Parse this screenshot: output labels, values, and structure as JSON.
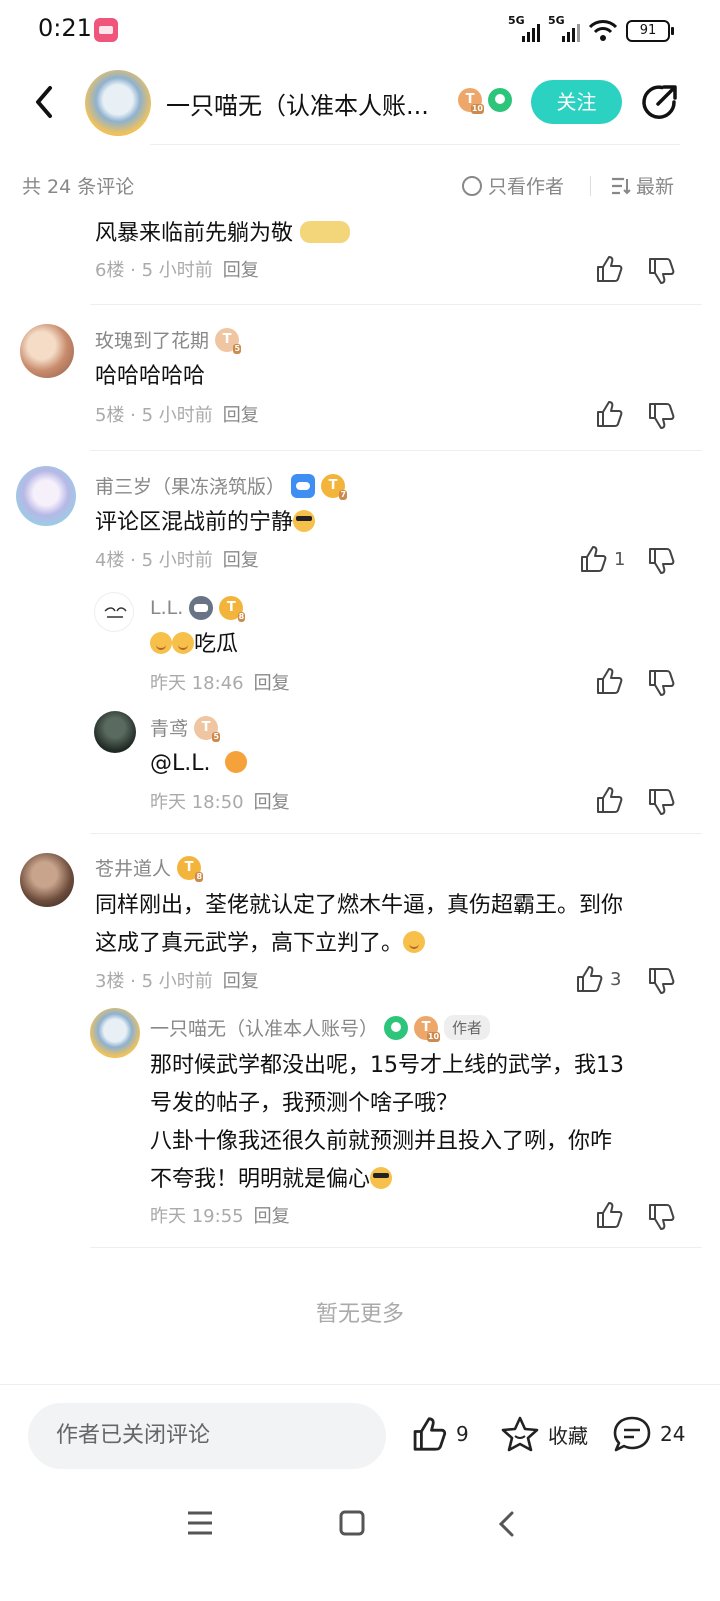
{
  "status_bar": {
    "time": "0:21",
    "signal1": "5G",
    "signal2": "5G",
    "battery": "91"
  },
  "header": {
    "title": "一只喵无（认准本人账...",
    "level_badge": "T",
    "level_num": "10",
    "follow_label": "关注"
  },
  "sort": {
    "total": "共 24 条评论",
    "only_author": "只看作者",
    "latest": "最新"
  },
  "comments": {
    "c6": {
      "text": "风暴来临前先躺为敬",
      "floor": "6楼 · 5 小时前",
      "reply": "回复"
    },
    "c5": {
      "user": "玫瑰到了花期",
      "lvl": "T",
      "lvl_num": "5",
      "text": "哈哈哈哈哈",
      "floor": "5楼 · 5 小时前",
      "reply": "回复"
    },
    "c4": {
      "user": "甫三岁（果冻浇筑版）",
      "lvl": "T",
      "lvl_num": "7",
      "text": "评论区混战前的宁静",
      "floor": "4楼 · 5 小时前",
      "reply": "回复",
      "likes": "1"
    },
    "r4a": {
      "user": "L.L.",
      "lvl": "T",
      "lvl_num": "8",
      "text": "吃瓜",
      "time": "昨天 18:46",
      "reply": "回复"
    },
    "r4b": {
      "user": "青鸢",
      "lvl": "T",
      "lvl_num": "5",
      "text": "@L.L.",
      "time": "昨天 18:50",
      "reply": "回复"
    },
    "c3": {
      "user": "苍井道人",
      "lvl": "T",
      "lvl_num": "8",
      "text1": "同样刚出，荃佬就认定了燃木牛逼，真伤超霸王。到你",
      "text2": "这成了真元武学，高下立判了。",
      "floor": "3楼 · 5 小时前",
      "reply": "回复",
      "likes": "3"
    },
    "r3a": {
      "user": "一只喵无（认准本人账号）",
      "lvl": "T",
      "lvl_num": "10",
      "author_tag": "作者",
      "text1": "那时候武学都没出呢，15号才上线的武学，我13",
      "text2": "号发的帖子，我预测个啥子哦？",
      "text3": "八卦十像我还很久前就预测并且投入了咧，你咋",
      "text4": "不夸我！明明就是偏心",
      "time": "昨天 19:55",
      "reply": "回复"
    }
  },
  "no_more": "暂无更多",
  "bottom": {
    "input_placeholder": "作者已关闭评论",
    "likes": "9",
    "favorite": "收藏",
    "comments": "24"
  }
}
